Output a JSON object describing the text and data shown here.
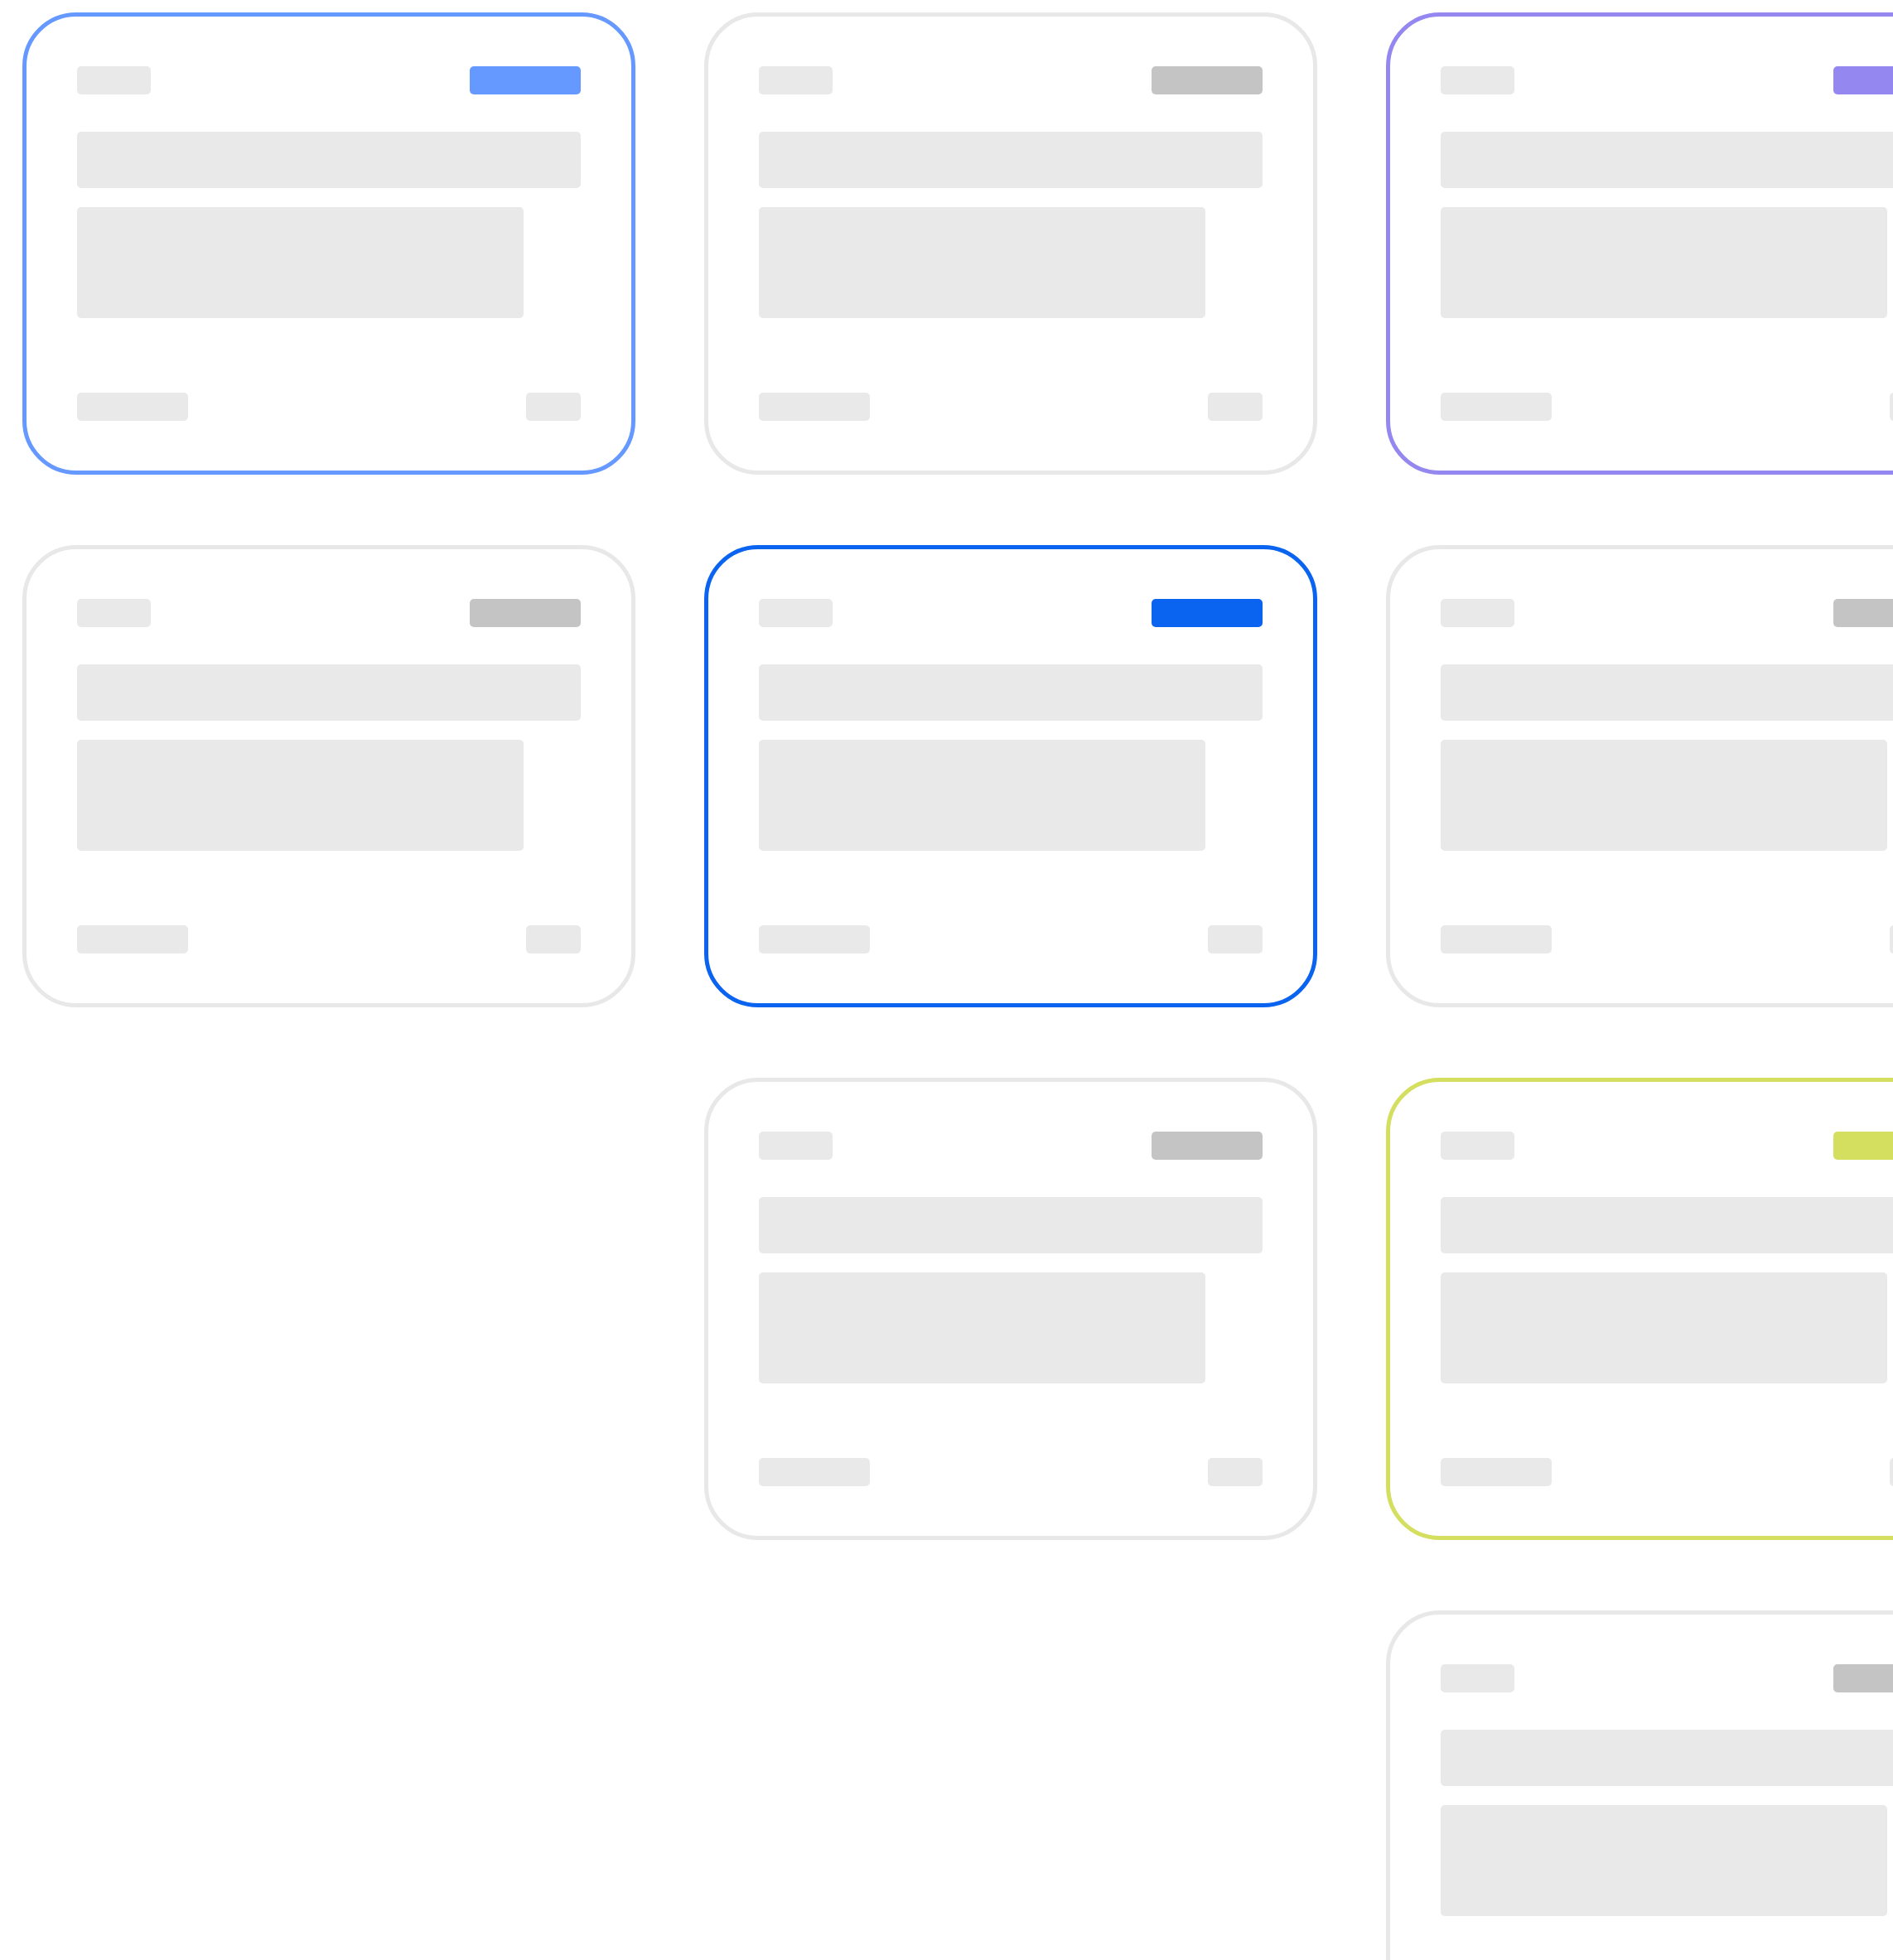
{
  "columns": [
    {
      "cards": [
        {
          "selected": true,
          "color": "#6699ff"
        },
        {
          "selected": false,
          "color": "#c4c4c4"
        }
      ]
    },
    {
      "cards": [
        {
          "selected": false,
          "color": "#c4c4c4"
        },
        {
          "selected": true,
          "color": "#0a64f0"
        },
        {
          "selected": false,
          "color": "#c4c4c4"
        }
      ]
    },
    {
      "cards": [
        {
          "selected": true,
          "color": "#9488f0"
        },
        {
          "selected": false,
          "color": "#c4c4c4"
        },
        {
          "selected": true,
          "color": "#d4df60"
        },
        {
          "selected": false,
          "color": "#c4c4c4"
        }
      ]
    }
  ]
}
